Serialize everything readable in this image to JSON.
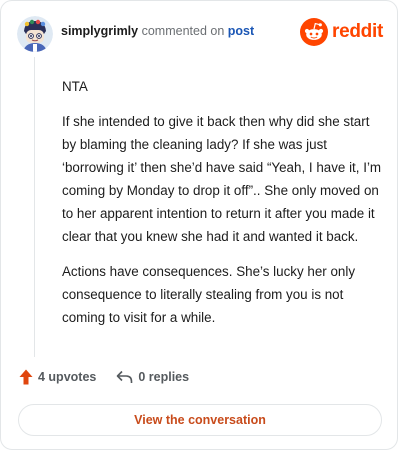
{
  "header": {
    "username": "simplygrimly",
    "action_text": "commented on",
    "post_link": "post",
    "brand_name": "reddit"
  },
  "comment": {
    "paragraphs": [
      "NTA",
      "If she intended to give it back then why did she start by blaming the cleaning lady? If she was just ‘borrowing it’ then she’d have said “Yeah, I have it, I’m coming by Monday to drop it off”.. She only moved on to her apparent intention to return it after you made it clear that you knew she had it and wanted it back.",
      "Actions have consequences. She’s lucky her only consequence to literally stealing from you is not coming to visit for a while."
    ]
  },
  "footer": {
    "upvotes_label": "4 upvotes",
    "replies_label": "0 replies",
    "view_button_label": "View the conversation"
  },
  "icons": {
    "avatar": "avatar-icon",
    "brand_logo": "reddit-logo-icon",
    "upvote": "upvote-arrow-icon",
    "reply": "reply-arrow-icon"
  },
  "colors": {
    "brand": "#ff4500",
    "post_link": "#1a56b5",
    "upvote": "#e0460e",
    "cta_text": "#c84b1b",
    "border": "#e3e6e8"
  }
}
